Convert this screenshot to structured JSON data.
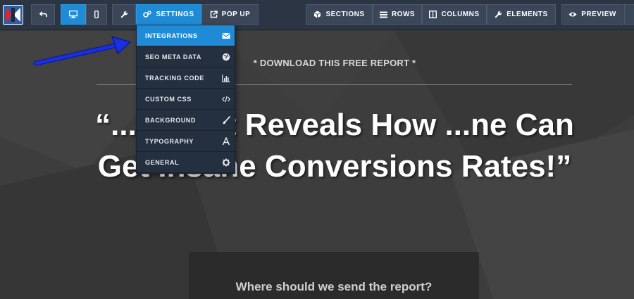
{
  "toolbar": {
    "settings_label": "SETTINGS",
    "popup_label": "POP UP",
    "sections_label": "SECTIONS",
    "rows_label": "ROWS",
    "columns_label": "COLUMNS",
    "elements_label": "ELEMENTS",
    "preview_label": "PREVIEW"
  },
  "settings_menu": {
    "items": [
      {
        "label": "INTEGRATIONS",
        "icon": "envelope-icon",
        "active": true
      },
      {
        "label": "SEO META DATA",
        "icon": "globe-icon"
      },
      {
        "label": "TRACKING CODE",
        "icon": "bar-chart-icon"
      },
      {
        "label": "CUSTOM CSS",
        "icon": "code-icon"
      },
      {
        "label": "BACKGROUND",
        "icon": "brush-icon"
      },
      {
        "label": "TYPOGRAPHY",
        "icon": "font-icon"
      },
      {
        "label": "GENERAL",
        "icon": "gear-icon"
      }
    ]
  },
  "page": {
    "kicker": "* DOWNLOAD THIS FREE REPORT *",
    "headline": "“...Report Reveals How ...ne Can Get Insane Conversions Rates!”",
    "form_question": "Where should we send the report?"
  },
  "colors": {
    "toolbar_bg": "#2b3544",
    "accent": "#1f8bd6",
    "menu_bg": "#243040",
    "arrow": "#1a2fe0",
    "canvas_bg": "#3d3d3d"
  }
}
